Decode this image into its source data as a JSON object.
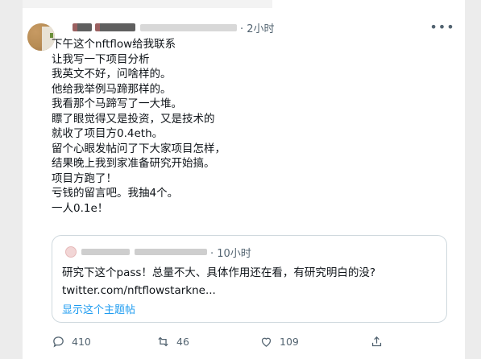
{
  "tweet": {
    "time": "· 2小时",
    "more_label": "•••",
    "lines": [
      "下午这个nftflow给我联系",
      "让我写一下项目分析",
      "我英文不好，问啥样的。",
      "他给我举例马蹄那样的。",
      "我看那个马蹄写了一大堆。",
      "瞟了眼觉得又是投资，又是技术的",
      "就收了项目方0.4eth。",
      "留个心眼发帖问了下大家项目怎样，",
      "结果晚上我到家准备研究开始搞。",
      "项目方跑了！",
      "亏钱的留言吧。我抽4个。",
      "一人0.1e！"
    ]
  },
  "quote": {
    "time": "· 10小时",
    "lines": [
      "研究下这个pass！总量不大、具体作用还在看，有研究明白的没?",
      "twitter.com/nftflowstarkne..."
    ],
    "show_thread": "显示这个主题帖"
  },
  "actions": {
    "reply_count": "410",
    "retweet_count": "46",
    "like_count": "109"
  },
  "colors": {
    "link": "#1d9bf0",
    "muted": "#536471",
    "border": "#cfd9de"
  }
}
